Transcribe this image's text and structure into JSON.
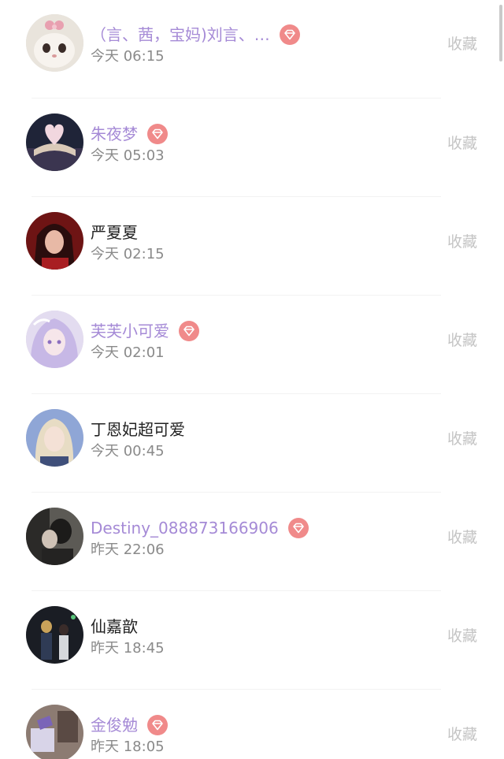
{
  "fav_label": "收藏",
  "colors": {
    "vip_name": "#a58ad6",
    "normal_name": "#222222",
    "time": "#8a8a8a",
    "fav": "#c4c4c4",
    "vip_badge": "#f08a8a"
  },
  "entries": [
    {
      "name": "（言、茜，宝妈)刘言、…",
      "time": "今天 06:15",
      "vip": true,
      "avatar_icon": "cat-avatar"
    },
    {
      "name": "朱夜梦",
      "time": "今天 05:03",
      "vip": true,
      "avatar_icon": "book-heart-avatar"
    },
    {
      "name": "严夏夏",
      "time": "今天 02:15",
      "vip": false,
      "avatar_icon": "girl-red-avatar"
    },
    {
      "name": "芙芙小可爱",
      "time": "今天 02:01",
      "vip": true,
      "avatar_icon": "anime-girl-avatar"
    },
    {
      "name": "丁恩妃超可爱",
      "time": "今天 00:45",
      "vip": false,
      "avatar_icon": "blonde-girl-avatar"
    },
    {
      "name": "Destiny_088873166906",
      "time": "昨天 22:06",
      "vip": true,
      "avatar_icon": "couple-dark-avatar"
    },
    {
      "name": "仙嘉歆",
      "time": "昨天 18:45",
      "vip": false,
      "avatar_icon": "anime-couple-avatar"
    },
    {
      "name": "金俊勉",
      "time": "昨天 18:05",
      "vip": true,
      "avatar_icon": "room-avatar"
    }
  ]
}
